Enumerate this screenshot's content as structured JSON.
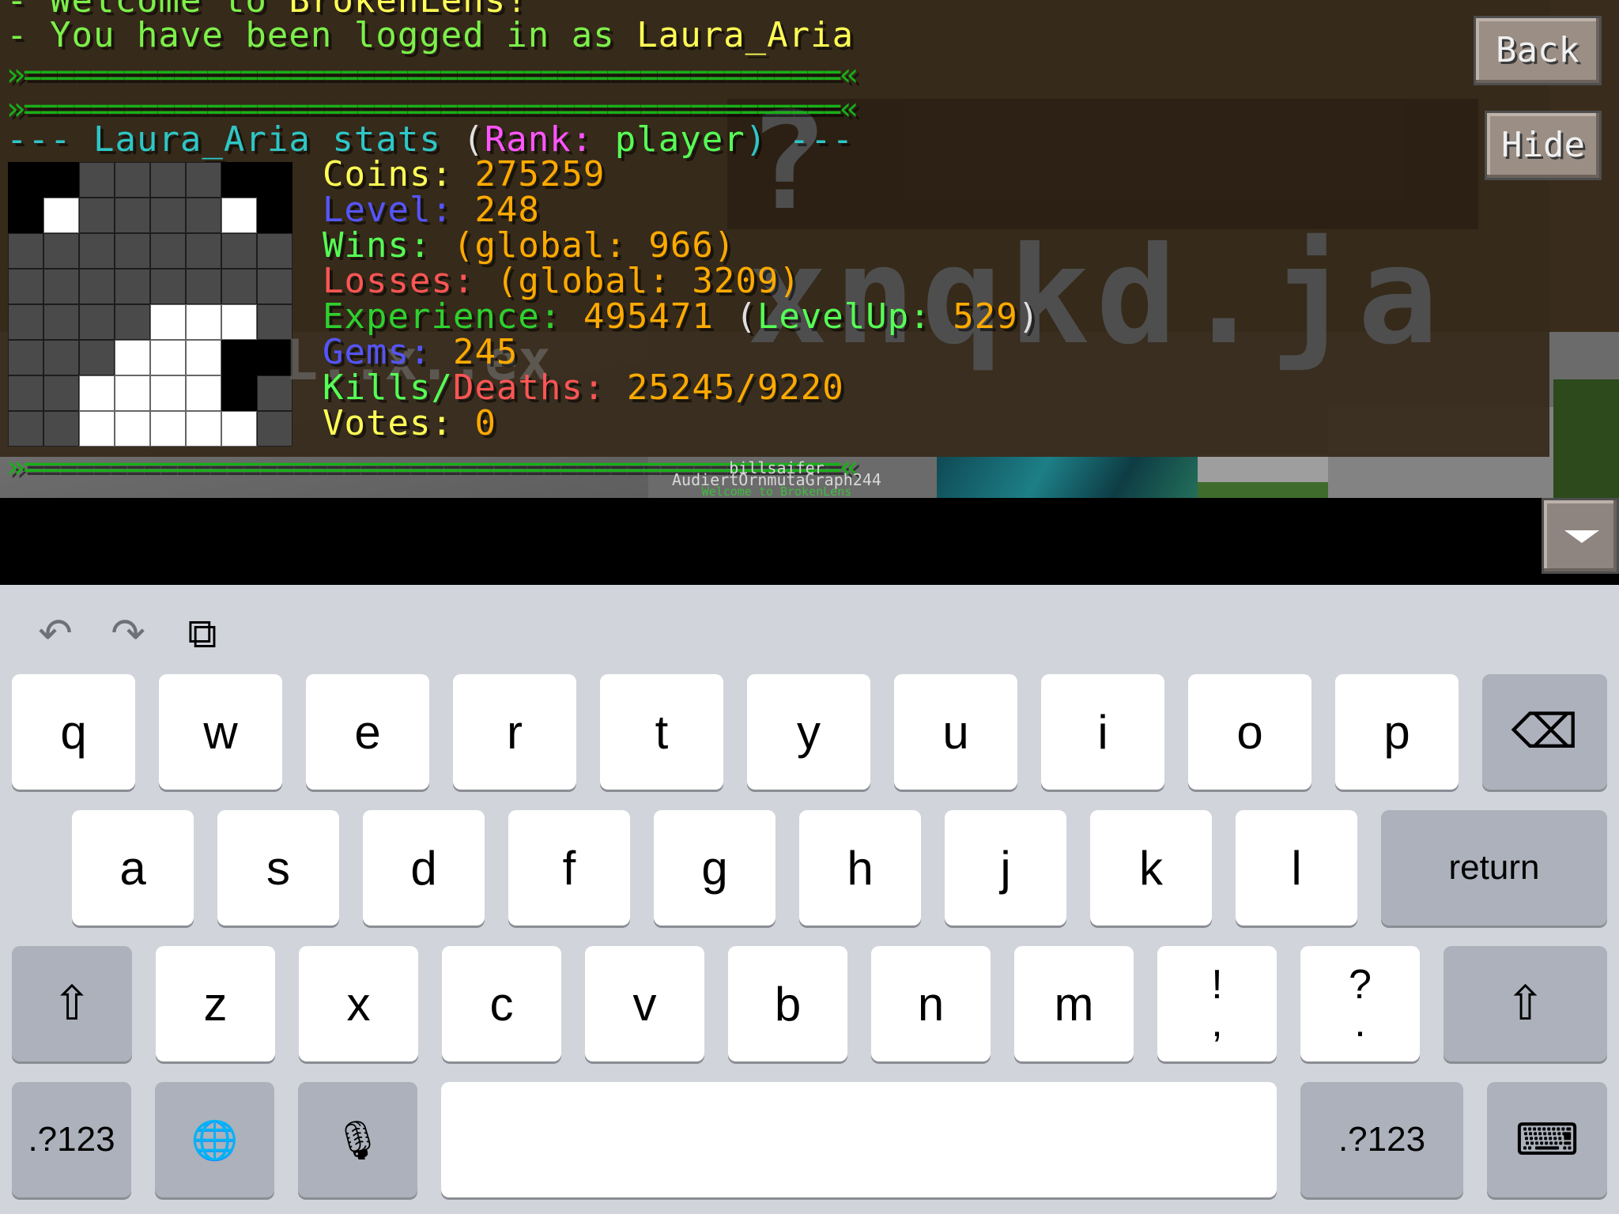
{
  "chat": {
    "welcome_prefix": "- Welcome to ",
    "welcome_server": "BrokenLens!",
    "logged_prefix": "- You have been logged in as ",
    "username": "Laura_Aria",
    "separator": "»=================================================«",
    "stats_header_prefix": "--- ",
    "stats_header_name": "Laura_Aria stats ",
    "rank_open": "(",
    "rank_label": "Rank:",
    "rank_value": " player",
    "rank_close": ") ---",
    "stats": {
      "coins_label": "Coins: ",
      "coins_value": "275259",
      "level_label": "Level: ",
      "level_value": "248",
      "wins_label": "Wins: ",
      "wins_value": "(global: 966)",
      "losses_label": "Losses: ",
      "losses_value": "(global: 3209)",
      "experience_label": "Experience: ",
      "experience_value": "495471 ",
      "levelup_open": "(",
      "levelup_label": "LevelUp: ",
      "levelup_value": "529",
      "levelup_close": ")",
      "gems_label": "Gems: ",
      "gems_value": "245",
      "kills_label": "Kills/",
      "deaths_label": "Deaths: ",
      "kd_value": "25245/9220",
      "votes_label": "Votes: ",
      "votes_value": "0"
    }
  },
  "overlay": {
    "text": "? xnqkd.ja",
    "ghost_tag": "L..x..ex",
    "nametag_1": "billsaifer",
    "nametag_2": "AudiertOrnmutaGraph244",
    "nametag_3": "Welcome to BrokenLens"
  },
  "buttons": {
    "back": "Back",
    "hide": "Hide"
  },
  "keyboard": {
    "row1": [
      "q",
      "w",
      "e",
      "r",
      "t",
      "y",
      "u",
      "i",
      "o",
      "p"
    ],
    "row2": [
      "a",
      "s",
      "d",
      "f",
      "g",
      "h",
      "j",
      "k",
      "l"
    ],
    "row3": [
      "z",
      "x",
      "c",
      "v",
      "b",
      "n",
      "m"
    ],
    "punct1_top": "!",
    "punct1_bottom": ",",
    "punct2_top": "?",
    "punct2_bottom": ".",
    "return": "return",
    "numbers_left": ".?123",
    "numbers_right": ".?123",
    "undo_icon": "↶",
    "redo_icon": "↷",
    "paste_icon": "⧉",
    "backspace_icon": "⌫",
    "shift_icon": "⇧",
    "globe_icon": "🌐",
    "mic_icon": "🎙",
    "hide_keyboard_icon": "⌨"
  }
}
